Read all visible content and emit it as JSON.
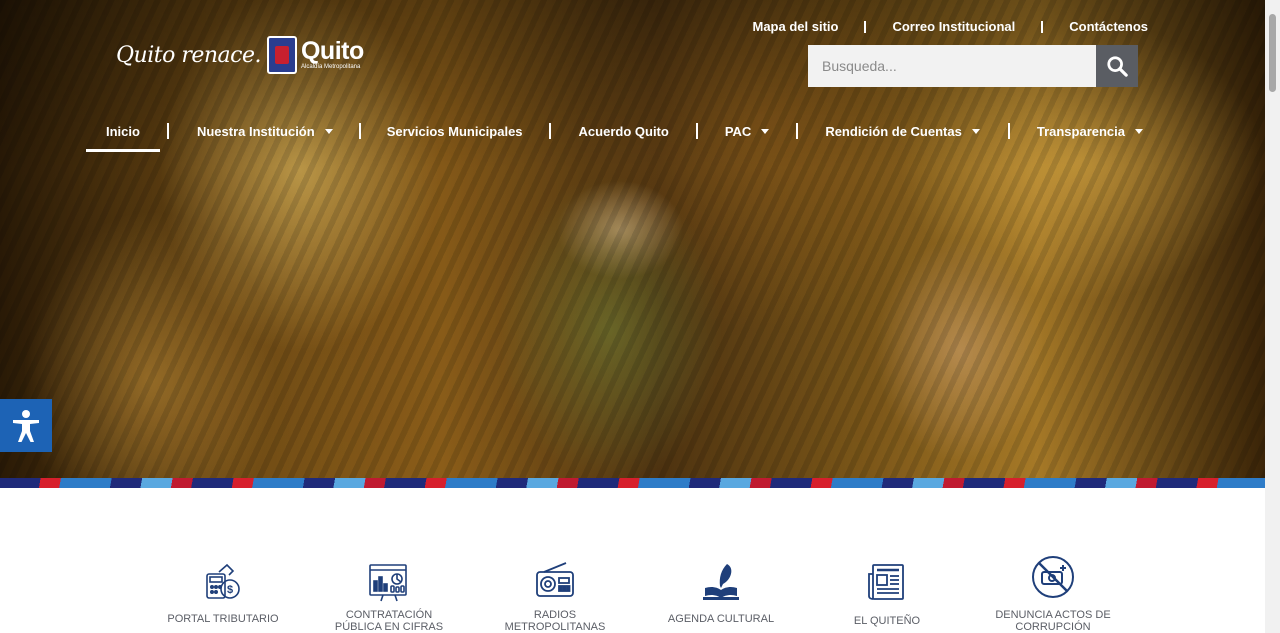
{
  "logo": {
    "slogan": "Quito renace.",
    "name": "Quito",
    "subtitle": "Alcaldía Metropolitana"
  },
  "top_links": [
    "Mapa del sitio",
    "Correo Institucional",
    "Contáctenos"
  ],
  "search": {
    "placeholder": "Busqueda...",
    "value": "",
    "icon": "search-icon"
  },
  "nav": {
    "items": [
      {
        "label": "Inicio",
        "active": true,
        "dropdown": false
      },
      {
        "label": "Nuestra Institución",
        "active": false,
        "dropdown": true
      },
      {
        "label": "Servicios Municipales",
        "active": false,
        "dropdown": false
      },
      {
        "label": "Acuerdo Quito",
        "active": false,
        "dropdown": false
      },
      {
        "label": "PAC",
        "active": false,
        "dropdown": true
      },
      {
        "label": "Rendición de Cuentas",
        "active": false,
        "dropdown": true
      },
      {
        "label": "Transparencia",
        "active": false,
        "dropdown": true
      }
    ]
  },
  "accessibility": {
    "icon": "accessibility-icon"
  },
  "services": [
    {
      "label": "PORTAL TRIBUTARIO",
      "icon": "tax-portal-icon"
    },
    {
      "label": "CONTRATACIÓN PÚBLICA EN CIFRAS",
      "icon": "procurement-stats-icon"
    },
    {
      "label": "RADIOS METROPOLITANAS",
      "icon": "radio-icon"
    },
    {
      "label": "AGENDA CULTURAL",
      "icon": "culture-book-icon"
    },
    {
      "label": "EL QUITEÑO",
      "icon": "newspaper-icon"
    },
    {
      "label": "DENUNCIA ACTOS DE CORRUPCIÓN",
      "icon": "no-corruption-icon"
    }
  ],
  "colors": {
    "icon_blue": "#1f3f7a",
    "accessibility_blue": "#1d63b5",
    "search_button": "#5a5d63",
    "label_gray": "#5b5e66"
  }
}
